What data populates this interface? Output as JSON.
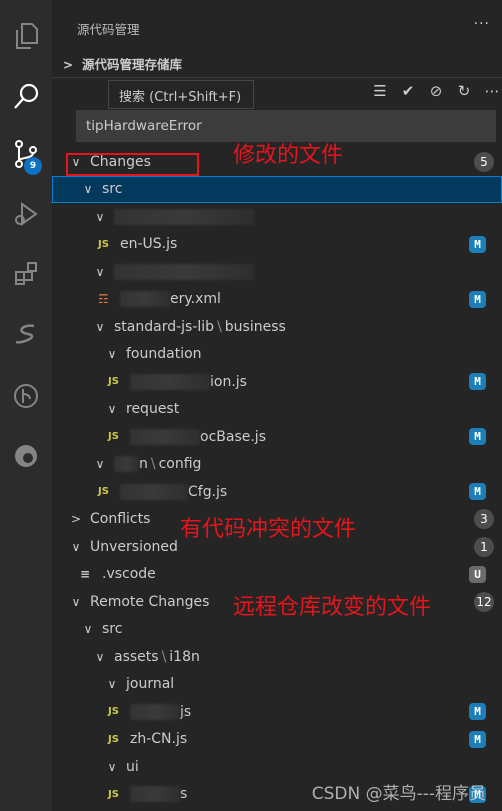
{
  "activity_bar": {
    "items": [
      {
        "icon": "files-icon"
      },
      {
        "icon": "search-icon"
      },
      {
        "icon": "source-control-icon",
        "badge": "9"
      },
      {
        "icon": "run-debug-icon"
      },
      {
        "icon": "extensions-icon"
      },
      {
        "icon": "svn-icon"
      },
      {
        "icon": "gitlens-icon"
      },
      {
        "icon": "edge-icon"
      }
    ]
  },
  "sidebar": {
    "title": "源代码管理",
    "more": "···",
    "repo_section": "源代码管理存储库",
    "tooltip": "搜索 (Ctrl+Shift+F)",
    "toolbar_icons": [
      "tree-view-icon",
      "commit-check-icon",
      "revert-icon",
      "refresh-icon",
      "more-icon"
    ],
    "commit_message": "tipHardwareError"
  },
  "tree": [
    {
      "type": "group",
      "label": "Changes",
      "level": 0,
      "open": true,
      "count": "5"
    },
    {
      "type": "folder",
      "label": "src",
      "level": 1,
      "open": true,
      "selected": true
    },
    {
      "type": "folder",
      "label": "",
      "level": 2,
      "open": true,
      "redacted": true
    },
    {
      "type": "file",
      "label": "en-US.js",
      "level": 2,
      "icon": "JS",
      "status": "M"
    },
    {
      "type": "folder",
      "label": "",
      "level": 2,
      "open": true,
      "redacted": true
    },
    {
      "type": "file",
      "label": "ery.xml",
      "level": 2,
      "icon": "rss",
      "status": "M",
      "redacted": true
    },
    {
      "type": "folder",
      "label": "standard-js-lib",
      "label2": "business",
      "level": 2,
      "open": true
    },
    {
      "type": "folder",
      "label": "foundation",
      "level": 3,
      "open": true
    },
    {
      "type": "file",
      "label": "ion.js",
      "level": 3,
      "icon": "JS",
      "status": "M",
      "redacted": true
    },
    {
      "type": "folder",
      "label": "request",
      "level": 3,
      "open": true
    },
    {
      "type": "file",
      "label": "ocBase.js",
      "level": 3,
      "icon": "JS",
      "status": "M",
      "redacted": true
    },
    {
      "type": "folder",
      "label": "n",
      "label2": "config",
      "level": 2,
      "open": true,
      "redacted": true
    },
    {
      "type": "file",
      "label": "Cfg.js",
      "level": 2,
      "icon": "JS",
      "status": "M",
      "redacted": true
    },
    {
      "type": "group",
      "label": "Conflicts",
      "level": 0,
      "open": false,
      "count": "3"
    },
    {
      "type": "group",
      "label": "Unversioned",
      "level": 0,
      "open": true,
      "count": "1"
    },
    {
      "type": "file",
      "label": ".vscode",
      "level": 1,
      "icon": "txt",
      "status": "U"
    },
    {
      "type": "group",
      "label": "Remote Changes",
      "level": 0,
      "open": true,
      "count": "12"
    },
    {
      "type": "folder",
      "label": "src",
      "level": 1,
      "open": true
    },
    {
      "type": "folder",
      "label": "assets",
      "label2": "i18n",
      "level": 2,
      "open": true
    },
    {
      "type": "folder",
      "label": "journal",
      "level": 3,
      "open": true
    },
    {
      "type": "file",
      "label": "js",
      "level": 3,
      "icon": "JS",
      "status": "M",
      "redacted": true
    },
    {
      "type": "file",
      "label": "zh-CN.js",
      "level": 3,
      "icon": "JS",
      "status": "M"
    },
    {
      "type": "folder",
      "label": "ui",
      "level": 3,
      "open": true
    },
    {
      "type": "file",
      "label": "s",
      "level": 3,
      "icon": "JS",
      "status": "M",
      "redacted": true
    }
  ],
  "annotations": {
    "changes": "修改的文件",
    "conflicts": "有代码冲突的文件",
    "remote": "远程仓库改变的文件"
  },
  "watermark": "CSDN @菜鸟---程序员",
  "colors": {
    "accent": "#0e70c0",
    "selection": "#04395e",
    "annotation": "#e8141b",
    "modified": "#1e7fb8"
  }
}
